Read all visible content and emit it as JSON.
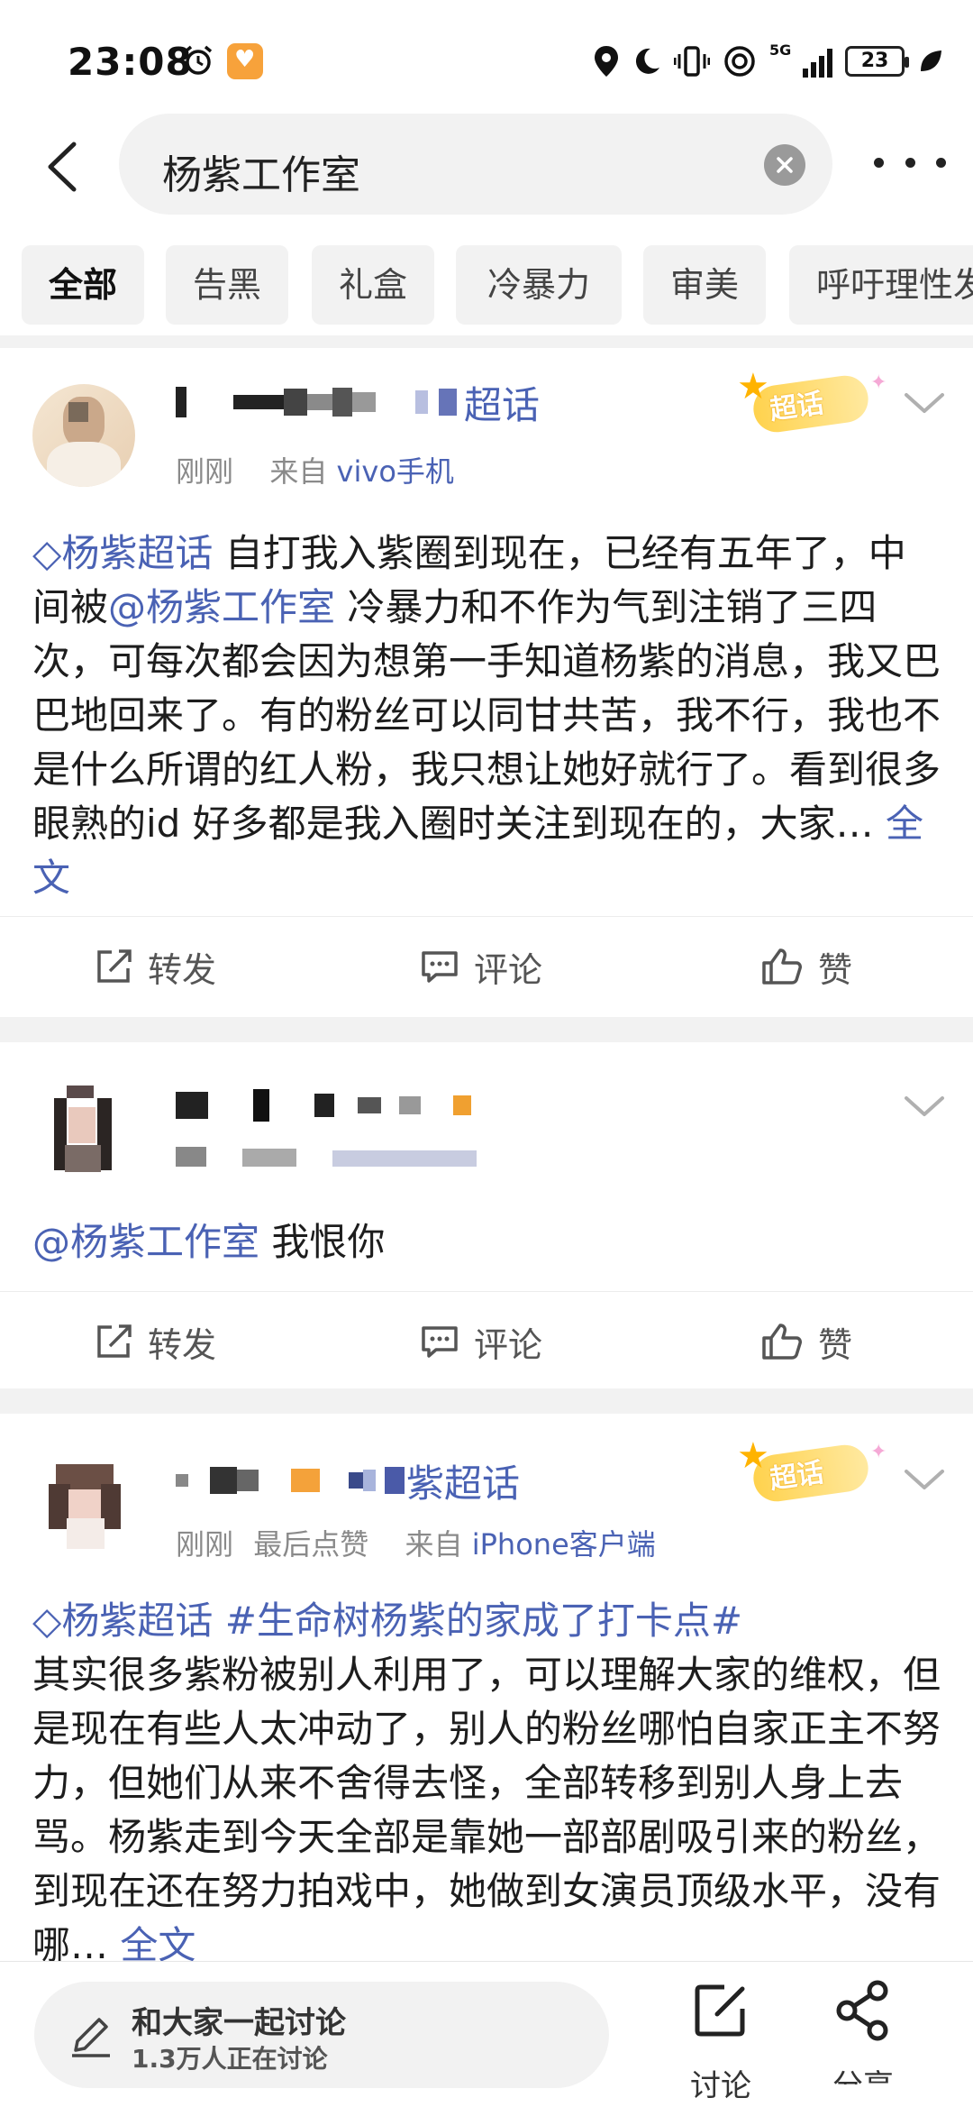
{
  "status_bar": {
    "time": "23:08",
    "network": "5G",
    "battery": "23"
  },
  "search": {
    "query": "杨紫工作室"
  },
  "tabs": [
    {
      "label": "全部",
      "active": true
    },
    {
      "label": "告黑",
      "active": false
    },
    {
      "label": "礼盒",
      "active": false
    },
    {
      "label": "冷暴力",
      "active": false
    },
    {
      "label": "审美",
      "active": false
    },
    {
      "label": "呼吁理性发",
      "active": false
    }
  ],
  "posts": [
    {
      "name_suffix": "超话",
      "badge": "超话",
      "time": "刚刚",
      "source_prefix": "来自",
      "source": "vivo手机",
      "topic": "杨紫超话",
      "text_a": "自打我入紫圈到现在，已经有五年了，中间被",
      "mention": "@杨紫工作室",
      "text_b": " 冷暴力和不作为气到注销了三四次，可每次都会因为想第一手知道杨紫的消息，我又巴巴地回来了。有的粉丝可以同甘共苦，我不行，我也不是什么所谓的红人粉，我只想让她好就行了。看到很多眼熟的id 好多都是我入圈时关注到现在的，大家…",
      "full_text": "全文",
      "actions": {
        "repost": "转发",
        "comment": "评论",
        "like": "赞"
      }
    },
    {
      "mention": "@杨紫工作室",
      "text": " 我恨你",
      "actions": {
        "repost": "转发",
        "comment": "评论",
        "like": "赞"
      }
    },
    {
      "name_suffix": "紫超话",
      "badge": "超话",
      "time": "刚刚",
      "liked": "最后点赞",
      "source_prefix": "来自",
      "source": "iPhone客户端",
      "topic": "杨紫超话",
      "hashtag": "#生命树杨紫的家成了打卡点#",
      "text": "其实很多紫粉被别人利用了，可以理解大家的维权，但是现在有些人太冲动了，别人的粉丝哪怕自家正主不努力，但她们从来不舍得去怪，全部转移到别人身上去骂。杨紫走到今天全部是靠她一部部剧吸引来的粉丝，到现在还在努力拍戏中，她做到女演员顶级水平，没有哪…",
      "full_text": "全文"
    }
  ],
  "bottom_bar": {
    "discuss_title": "和大家一起讨论",
    "discuss_count": "1.3万人正在讨论",
    "discuss_button": "讨论",
    "share_button": "分享"
  },
  "colors": {
    "link": "#4a62b4",
    "divider": "#f2f2f2",
    "badge": "#ffd24d"
  }
}
